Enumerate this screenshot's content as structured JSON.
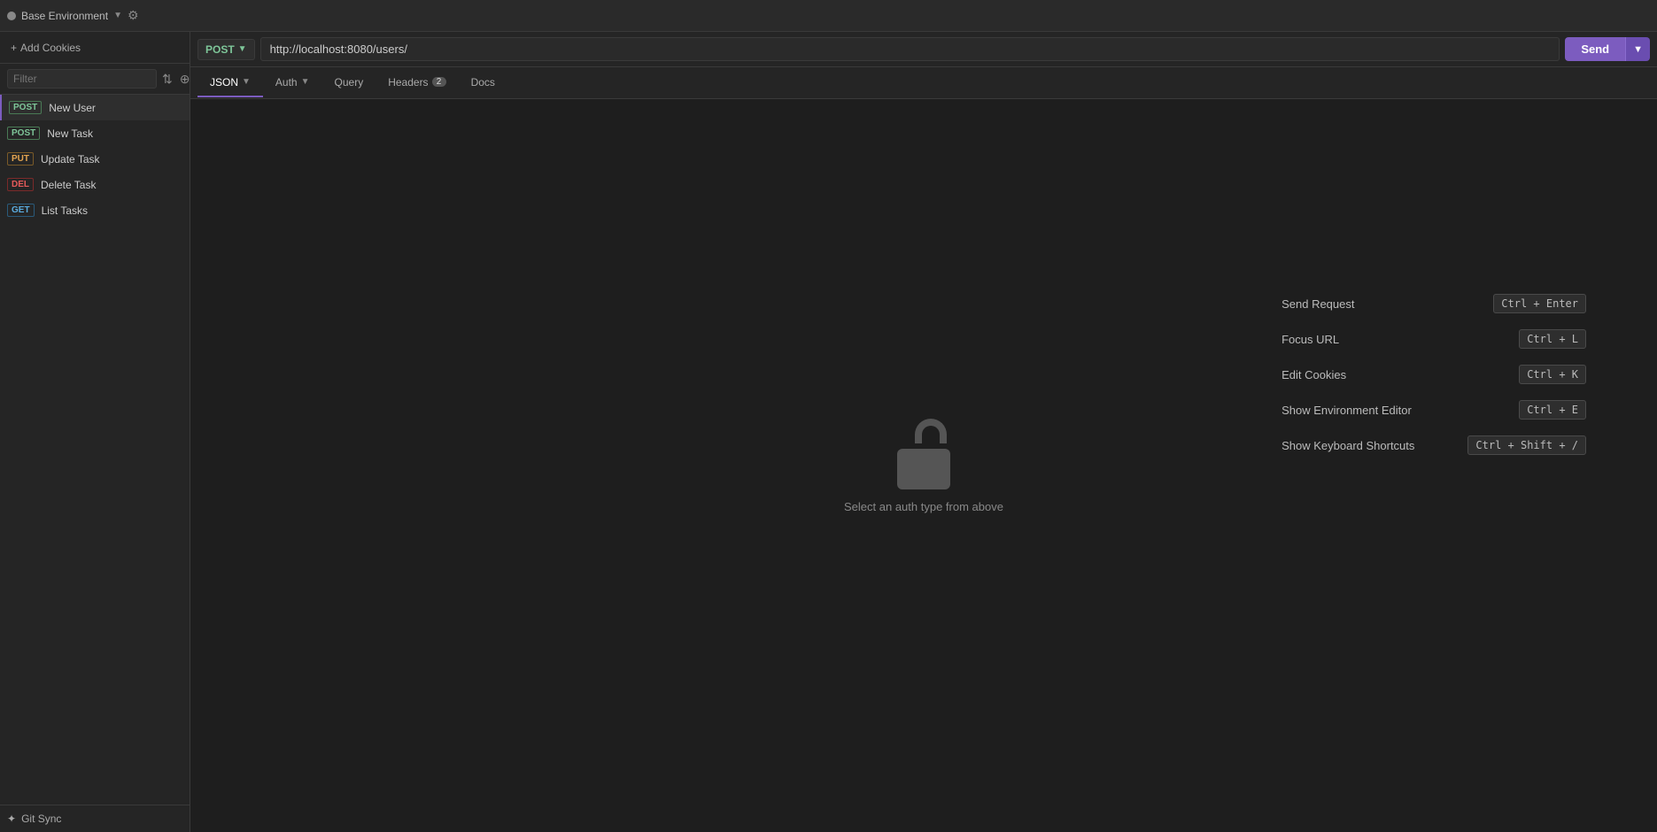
{
  "topbar": {
    "env_label": "Base Environment",
    "env_dot_color": "#888",
    "gear_icon": "⚙"
  },
  "sidebar": {
    "cookies_label": "Add Cookies",
    "filter_placeholder": "Filter",
    "items": [
      {
        "id": "new-user",
        "method": "POST",
        "method_class": "method-post",
        "name": "New User",
        "active": true
      },
      {
        "id": "new-task",
        "method": "POST",
        "method_class": "method-post",
        "name": "New Task",
        "active": false
      },
      {
        "id": "update-task",
        "method": "PUT",
        "method_class": "method-put",
        "name": "Update Task",
        "active": false
      },
      {
        "id": "delete-task",
        "method": "DEL",
        "method_class": "method-del",
        "name": "Delete Task",
        "active": false
      },
      {
        "id": "list-tasks",
        "method": "GET",
        "method_class": "method-get",
        "name": "List Tasks",
        "active": false
      }
    ],
    "git_sync_label": "Git Sync"
  },
  "urlbar": {
    "method": "POST",
    "url": "http://localhost:8080/users/",
    "send_label": "Send"
  },
  "tabs": [
    {
      "id": "json",
      "label": "JSON",
      "has_arrow": true,
      "badge": null,
      "active": true
    },
    {
      "id": "auth",
      "label": "Auth",
      "has_arrow": true,
      "badge": null,
      "active": false
    },
    {
      "id": "query",
      "label": "Query",
      "has_arrow": false,
      "badge": null,
      "active": false
    },
    {
      "id": "headers",
      "label": "Headers",
      "has_arrow": false,
      "badge": "2",
      "active": false
    },
    {
      "id": "docs",
      "label": "Docs",
      "has_arrow": false,
      "badge": null,
      "active": false
    }
  ],
  "auth_panel": {
    "hint_text": "Select an auth type from above"
  },
  "shortcuts": [
    {
      "id": "send-request",
      "label": "Send Request",
      "key": "Ctrl + Enter"
    },
    {
      "id": "focus-url",
      "label": "Focus URL",
      "key": "Ctrl + L"
    },
    {
      "id": "edit-cookies",
      "label": "Edit Cookies",
      "key": "Ctrl + K"
    },
    {
      "id": "show-env-editor",
      "label": "Show Environment Editor",
      "key": "Ctrl + E"
    },
    {
      "id": "show-keyboard-shortcuts",
      "label": "Show Keyboard Shortcuts",
      "key": "Ctrl + Shift + /"
    }
  ]
}
